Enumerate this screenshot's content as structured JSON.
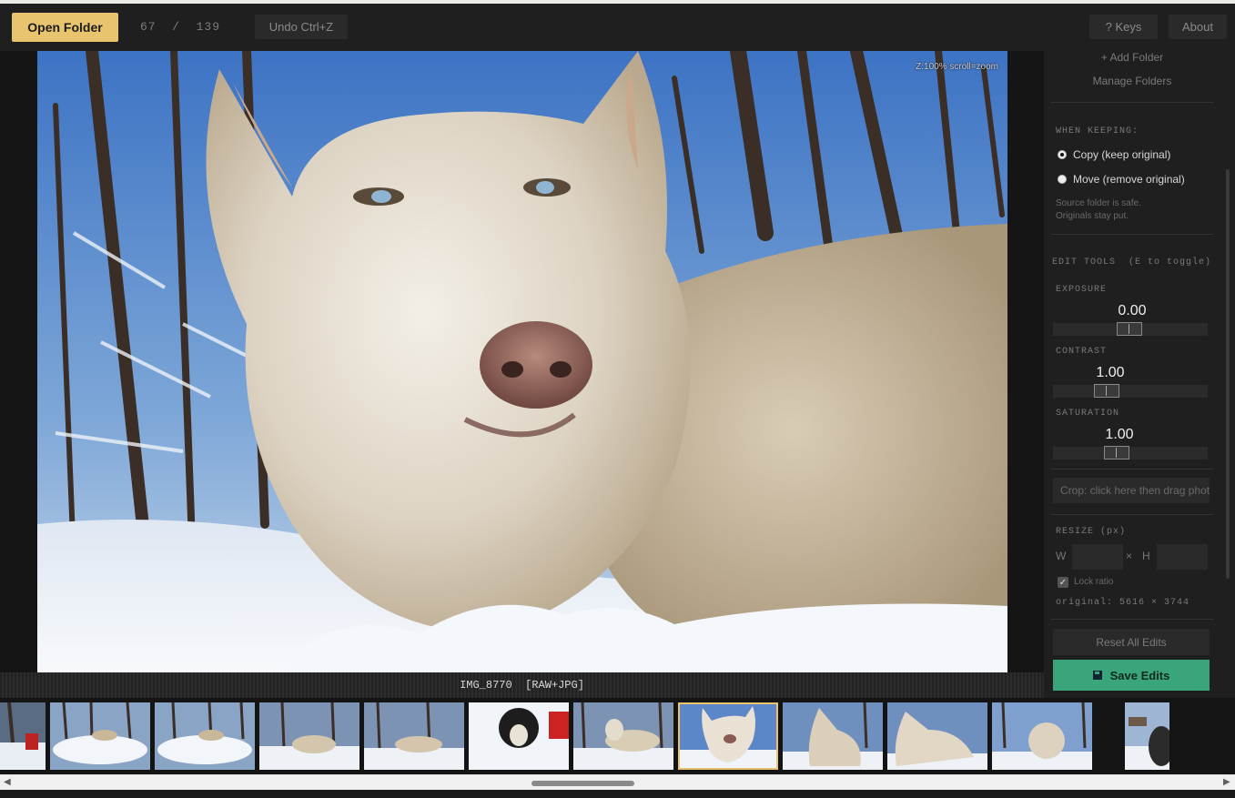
{
  "toolbar": {
    "open_folder": "Open Folder",
    "counter": "67  /  139",
    "undo": "Undo  Ctrl+Z",
    "keys": "?  Keys",
    "about": "About"
  },
  "viewer": {
    "zoom_hint": "Z:100%  scroll=zoom",
    "caption": "IMG_8770  [RAW+JPG]"
  },
  "sidebar": {
    "add_folder": "+ Add Folder",
    "manage_folders": "Manage Folders",
    "when_keeping": "WHEN KEEPING:",
    "copy_option": "Copy  (keep original)",
    "move_option": "Move  (remove original)",
    "copy_selected": true,
    "note_line1": "Source folder is safe.",
    "note_line2": "Originals stay put.",
    "edit_tools": "EDIT TOOLS  (E to toggle)",
    "exposure_label": "EXPOSURE",
    "exposure_value": "0.00",
    "contrast_label": "CONTRAST",
    "contrast_value": "1.00",
    "saturation_label": "SATURATION",
    "saturation_value": "1.00",
    "crop_placeholder": "Crop: click here then drag photo",
    "resize_label": "RESIZE (px)",
    "w_label": "W",
    "x_sep": "×",
    "h_label": "H",
    "lock_ratio": "Lock ratio",
    "original": "original: 5616 × 3744",
    "reset_all": "Reset All Edits",
    "save_edits": "Save Edits"
  },
  "colors": {
    "accent": "#e8c46e",
    "save": "#3aa57a",
    "background": "#1c1c1c"
  },
  "filmstrip": {
    "thumbnail_count": 12,
    "current_index": 7
  }
}
